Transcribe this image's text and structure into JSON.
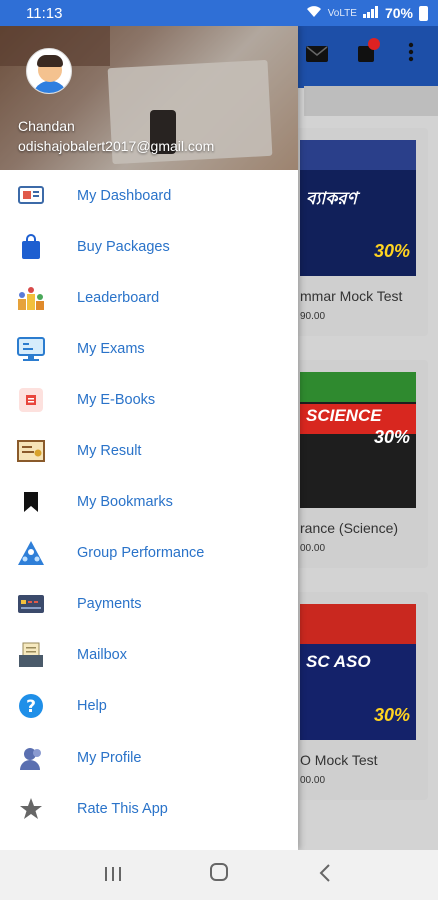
{
  "status_bar": {
    "time": "11:13",
    "battery": "70%",
    "signal_text": "VoLTE"
  },
  "background_app": {
    "cards": [
      {
        "title": "mmar Mock Test",
        "price": "90.00",
        "cover_text": "ব্যাকরণ",
        "cover_pct": "30%"
      },
      {
        "title": "rance (Science)",
        "price": "00.00",
        "cover_text": "SCIENCE",
        "cover_pct": "30%"
      },
      {
        "title": "O Mock Test",
        "price": "00.00",
        "cover_text": "SC ASO",
        "cover_pct": "30%"
      }
    ]
  },
  "drawer": {
    "user": {
      "name": "Chandan",
      "email": "odishajobalert2017@gmail.com"
    },
    "items": [
      {
        "label": "My Dashboard",
        "icon": "dashboard-icon"
      },
      {
        "label": "Buy Packages",
        "icon": "shopping-bag-icon"
      },
      {
        "label": "Leaderboard",
        "icon": "leaderboard-icon"
      },
      {
        "label": "My Exams",
        "icon": "monitor-exam-icon"
      },
      {
        "label": "My E-Books",
        "icon": "ebook-icon"
      },
      {
        "label": "My Result",
        "icon": "certificate-icon"
      },
      {
        "label": "My Bookmarks",
        "icon": "bookmark-icon"
      },
      {
        "label": "Group Performance",
        "icon": "group-performance-icon"
      },
      {
        "label": "Payments",
        "icon": "payment-card-icon"
      },
      {
        "label": "Mailbox",
        "icon": "mailbox-icon"
      },
      {
        "label": "Help",
        "icon": "help-icon"
      },
      {
        "label": "My Profile",
        "icon": "profile-icon"
      },
      {
        "label": "Rate This App",
        "icon": "star-icon"
      }
    ]
  },
  "colors": {
    "status_bar": "#2f6fd6",
    "menu_text": "#2a73c9"
  }
}
